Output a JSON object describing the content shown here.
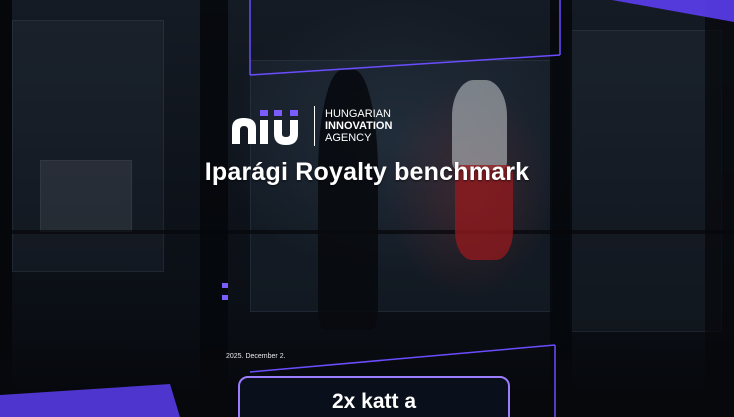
{
  "logo": {
    "line1": "HUNGARIAN",
    "line2": "INNOVATION",
    "line3": "AGENCY",
    "mark_icon": "hiu-logo-mark"
  },
  "slide": {
    "title": "Iparági Royalty benchmark",
    "date": "2025. December 2.",
    "cta_label": "2x katt a"
  },
  "colors": {
    "accent_purple": "#7b5cff",
    "accent_violet": "#9b7dff",
    "background": "#0a0d14",
    "text": "#ffffff"
  }
}
